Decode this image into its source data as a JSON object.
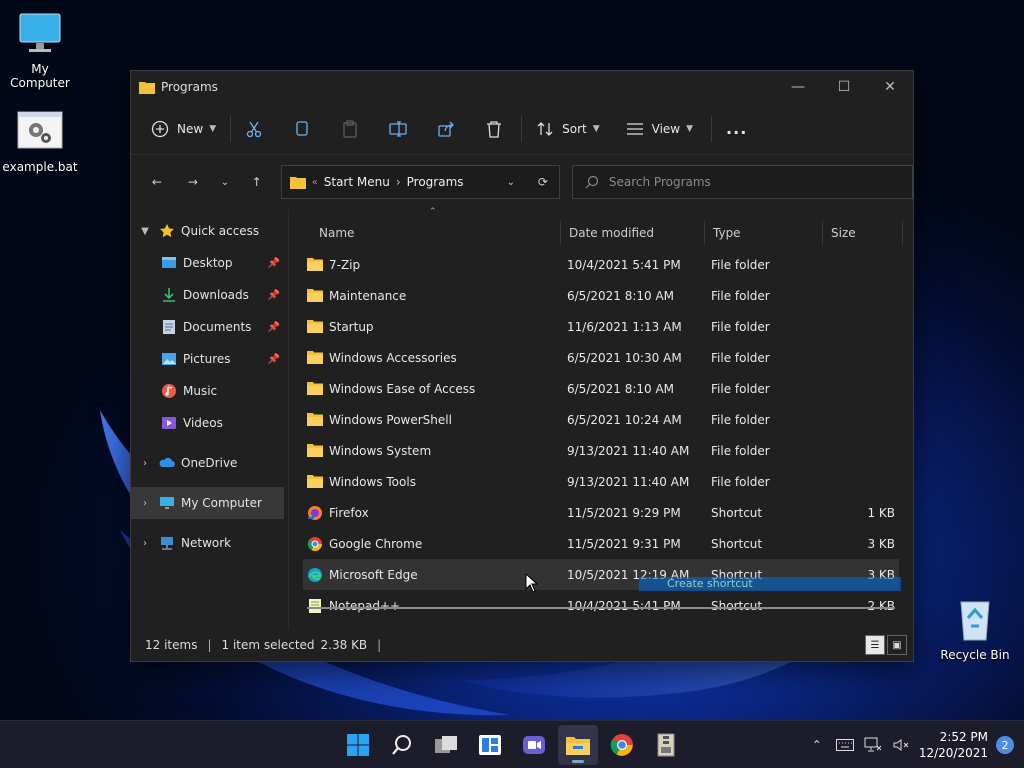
{
  "desktop": {
    "icons": [
      {
        "label": "My Computer",
        "icon": "monitor-icon"
      },
      {
        "label": "example.bat",
        "icon": "batch-file-icon"
      },
      {
        "label": "Recycle Bin",
        "icon": "recycle-bin-icon"
      }
    ]
  },
  "window": {
    "title": "Programs",
    "toolbar": {
      "new_label": "New",
      "sort_label": "Sort",
      "view_label": "View",
      "more_label": "..."
    },
    "address": {
      "prefix": "«",
      "crumbs": [
        "Start Menu",
        "Programs"
      ]
    },
    "search": {
      "placeholder": "Search Programs"
    },
    "nav": {
      "quick_access": "Quick access",
      "items": [
        "Desktop",
        "Downloads",
        "Documents",
        "Pictures",
        "Music",
        "Videos"
      ],
      "onedrive": "OneDrive",
      "my_computer": "My Computer",
      "network": "Network"
    },
    "columns": {
      "name": "Name",
      "date": "Date modified",
      "type": "Type",
      "size": "Size"
    },
    "rows": [
      {
        "name": "7-Zip",
        "date": "10/4/2021 5:41 PM",
        "type": "File folder",
        "size": ""
      },
      {
        "name": "Maintenance",
        "date": "6/5/2021 8:10 AM",
        "type": "File folder",
        "size": ""
      },
      {
        "name": "Startup",
        "date": "11/6/2021 1:13 AM",
        "type": "File folder",
        "size": ""
      },
      {
        "name": "Windows Accessories",
        "date": "6/5/2021 10:30 AM",
        "type": "File folder",
        "size": ""
      },
      {
        "name": "Windows Ease of Access",
        "date": "6/5/2021 8:10 AM",
        "type": "File folder",
        "size": ""
      },
      {
        "name": "Windows PowerShell",
        "date": "6/5/2021 10:24 AM",
        "type": "File folder",
        "size": ""
      },
      {
        "name": "Windows System",
        "date": "9/13/2021 11:40 AM",
        "type": "File folder",
        "size": ""
      },
      {
        "name": "Windows Tools",
        "date": "9/13/2021 11:40 AM",
        "type": "File folder",
        "size": ""
      },
      {
        "name": "Firefox",
        "date": "11/5/2021 9:29 PM",
        "type": "Shortcut",
        "size": "1 KB"
      },
      {
        "name": "Google Chrome",
        "date": "11/5/2021 9:31 PM",
        "type": "Shortcut",
        "size": "3 KB"
      },
      {
        "name": "Microsoft Edge",
        "date": "10/5/2021 12:19 AM",
        "type": "Shortcut",
        "size": "3 KB"
      },
      {
        "name": "Notepad++",
        "date": "10/4/2021 5:41 PM",
        "type": "Shortcut",
        "size": "2 KB"
      }
    ],
    "drag_hint": "Create shortcut",
    "status": {
      "count": "12 items",
      "selected": "1 item selected",
      "size": "2.38 KB"
    }
  },
  "taskbar": {
    "time": "2:52 PM",
    "date": "12/20/2021",
    "notifications": "2"
  },
  "colors": {
    "folder": "#f3c13a",
    "accent": "#4e8de6",
    "window_bg": "#202020"
  }
}
